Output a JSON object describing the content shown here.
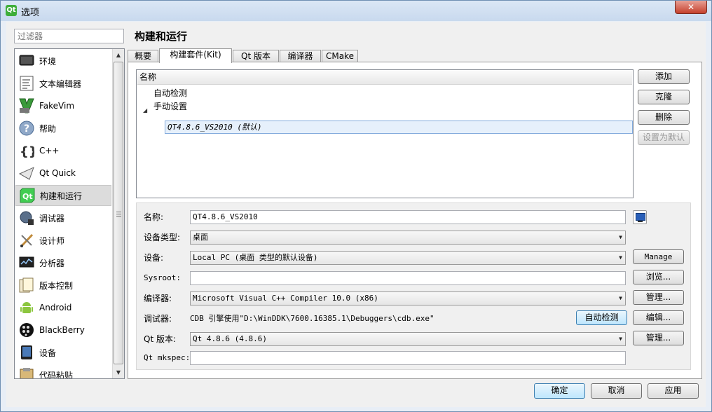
{
  "window": {
    "title": "选项",
    "app_icon_text": "Qt"
  },
  "sidebar": {
    "filter_placeholder": "过滤器",
    "items": [
      {
        "label": "环境",
        "icon": "monitor-icon"
      },
      {
        "label": "文本编辑器",
        "icon": "text-editor-icon"
      },
      {
        "label": "FakeVim",
        "icon": "fakevim-icon"
      },
      {
        "label": "帮助",
        "icon": "help-icon"
      },
      {
        "label": "C++",
        "icon": "braces-icon"
      },
      {
        "label": "Qt Quick",
        "icon": "paper-plane-icon"
      },
      {
        "label": "构建和运行",
        "icon": "qt-build-icon",
        "selected": true
      },
      {
        "label": "调试器",
        "icon": "debugger-icon"
      },
      {
        "label": "设计师",
        "icon": "designer-icon"
      },
      {
        "label": "分析器",
        "icon": "analyzer-icon"
      },
      {
        "label": "版本控制",
        "icon": "version-control-icon"
      },
      {
        "label": "Android",
        "icon": "android-icon"
      },
      {
        "label": "BlackBerry",
        "icon": "blackberry-icon"
      },
      {
        "label": "设备",
        "icon": "device-icon"
      },
      {
        "label": "代码粘贴",
        "icon": "code-paste-icon"
      }
    ]
  },
  "page": {
    "title": "构建和运行",
    "tabs": [
      {
        "label": "概要"
      },
      {
        "label": "构建套件(Kit)",
        "active": true
      },
      {
        "label": "Qt 版本"
      },
      {
        "label": "编译器"
      },
      {
        "label": "CMake"
      }
    ]
  },
  "kits": {
    "header": "名称",
    "auto_detected": "自动检测",
    "manual": "手动设置",
    "selected_kit": "QT4.8.6_VS2010 (默认)"
  },
  "kit_buttons": {
    "add": "添加",
    "clone": "克隆",
    "remove": "删除",
    "make_default": "设置为默认"
  },
  "form": {
    "name_label": "名称:",
    "name_value": "QT4.8.6_VS2010",
    "device_type_label": "设备类型:",
    "device_type_value": "桌面",
    "device_label": "设备:",
    "device_value": "Local PC (桌面 类型的默认设备)",
    "device_button": "Manage",
    "sysroot_label": "Sysroot:",
    "sysroot_value": "",
    "sysroot_button": "浏览...",
    "compiler_label": "编译器:",
    "compiler_value": "Microsoft Visual C++ Compiler 10.0 (x86)",
    "compiler_button": "管理...",
    "debugger_label": "调试器:",
    "debugger_value": "CDB 引擎使用\"D:\\WinDDK\\7600.16385.1\\Debuggers\\cdb.exe\"",
    "debugger_auto_button": "自动检测",
    "debugger_edit_button": "编辑...",
    "qt_version_label": "Qt 版本:",
    "qt_version_value": "Qt 4.8.6 (4.8.6)",
    "qt_version_button": "管理...",
    "mkspec_label": "Qt mkspec:",
    "mkspec_value": ""
  },
  "dialog_buttons": {
    "ok": "确定",
    "cancel": "取消",
    "apply": "应用"
  }
}
